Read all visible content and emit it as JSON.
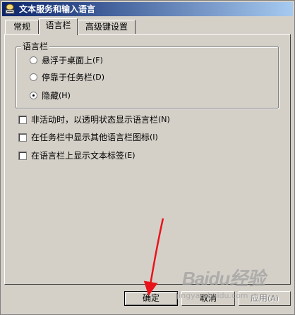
{
  "window": {
    "title": "文本服务和输入语言"
  },
  "tabs": [
    {
      "label": "常规"
    },
    {
      "label": "语言栏"
    },
    {
      "label": "高级键设置"
    }
  ],
  "group": {
    "title": "语言栏",
    "options": [
      {
        "label": "悬浮于桌面上",
        "key": "(F)",
        "checked": false
      },
      {
        "label": "停靠于任务栏",
        "key": "(D)",
        "checked": false
      },
      {
        "label": "隐藏",
        "key": "(H)",
        "checked": true
      }
    ]
  },
  "checkboxes": [
    {
      "label": "非活动时，以透明状态显示语言栏",
      "key": "(N)",
      "checked": false
    },
    {
      "label": "在任务栏中显示其他语言栏图标",
      "key": "(I)",
      "checked": false
    },
    {
      "label": "在语言栏上显示文本标签",
      "key": "(E)",
      "checked": false
    }
  ],
  "buttons": {
    "ok": "确定",
    "cancel": "取消",
    "apply": "应用",
    "apply_key": "(A)"
  },
  "colors": {
    "annotation_arrow": "#e8131b",
    "title_bar_start": "#0a246a",
    "title_bar_end": "#a6caf0"
  },
  "watermark": {
    "brand": "Baidu经验",
    "url": "jingyan.baidu.com"
  }
}
